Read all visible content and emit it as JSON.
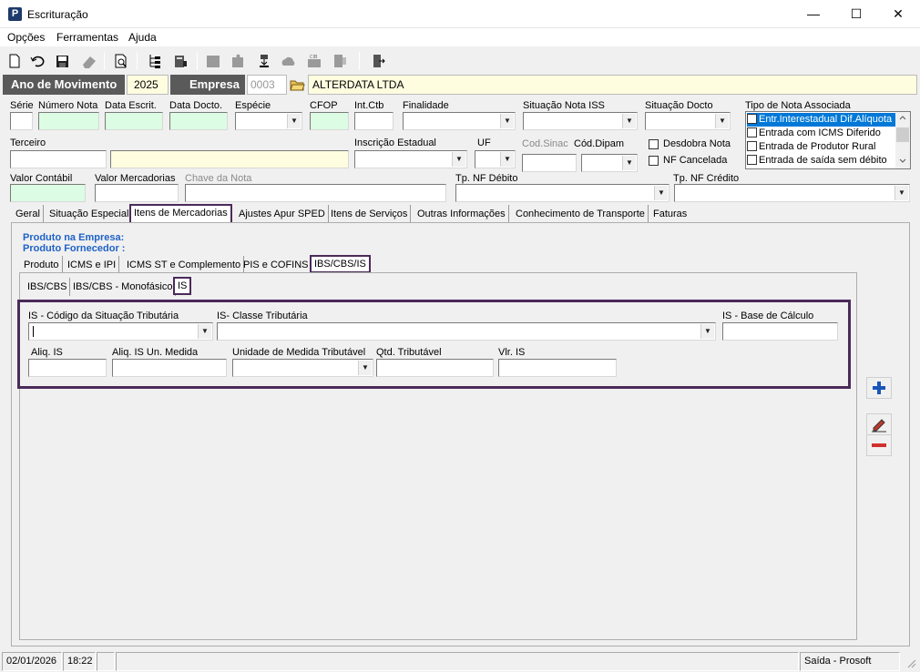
{
  "window": {
    "title": "Escrituração",
    "app_icon_letter": "P",
    "minimize": "—",
    "maximize": "☐",
    "close": "✕"
  },
  "menu": [
    "Opções",
    "Ferramentas",
    "Ajuda"
  ],
  "toolbar_icons": [
    "new-document-icon",
    "undo-icon",
    "save-icon",
    "eraser-icon",
    "print-preview-icon",
    "tree-view-icon",
    "book-icon",
    "folder-icon",
    "puzzle-icon",
    "import-icon",
    "cloud-icon",
    "cib-icon",
    "export-icon",
    "exit-door-icon"
  ],
  "header": {
    "ano_label": "Ano de Movimento",
    "ano_value": "2025",
    "empresa_label": "Empresa",
    "empresa_code": "0003",
    "empresa_name": "ALTERDATA LTDA"
  },
  "form": {
    "serie": "Série",
    "numero_nota": "Número Nota",
    "data_escrit": "Data Escrit.",
    "data_docto": "Data Docto.",
    "especie": "Espécie",
    "cfop": "CFOP",
    "int_ctb": "Int.Ctb",
    "finalidade": "Finalidade",
    "situacao_nota_iss": "Situação Nota ISS",
    "situacao_docto": "Situação Docto",
    "tipo_nota_associada": "Tipo de Nota Associada",
    "terceiro": "Terceiro",
    "inscricao_estadual": "Inscrição Estadual",
    "uf": "UF",
    "cod_sinac": "Cod.Sinac",
    "cod_dipam": "Cód.Dipam",
    "desdobra_nota": "Desdobra Nota",
    "nf_cancelada": "NF Cancelada",
    "valor_contabil": "Valor Contábil",
    "valor_mercadorias": "Valor Mercadorias",
    "chave_nota": "Chave da Nota",
    "tp_nf_debito": "Tp. NF Débito",
    "tp_nf_credito": "Tp. NF Crédito"
  },
  "tipo_nota_list": [
    "Entr.Interestadual Dif.Alíquota",
    "Entrada com ICMS Diferido",
    "Entrada de Produtor Rural",
    "Entrada de saída sem débito"
  ],
  "main_tabs": [
    "Geral",
    "Situação Especial",
    "Itens de Mercadorias",
    "Ajustes Apur SPED",
    "Itens de Serviços",
    "Outras Informações",
    "Conhecimento de Transporte",
    "Faturas"
  ],
  "produto_empresa": "Produto na Empresa:",
  "produto_fornecedor": "Produto Fornecedor :",
  "sub_tabs": [
    "Produto",
    "ICMS e IPI",
    "ICMS ST e Complemento",
    "PIS e COFINS",
    "IBS/CBS/IS"
  ],
  "sub_sub_tabs": [
    "IBS/CBS",
    "IBS/CBS - Monofásico",
    "IS"
  ],
  "is_panel": {
    "cst": "IS - Código da Situação Tributária",
    "classe": "IS- Classe Tributária",
    "base": "IS - Base de Cálculo",
    "aliq": "Aliq. IS",
    "aliq_un": "Aliq. IS Un. Medida",
    "unidade": "Unidade de Medida Tributável",
    "qtd": "Qtd. Tributável",
    "vlr": "Vlr. IS"
  },
  "status": {
    "date": "02/01/2026",
    "time": "18:22",
    "mode": "Saída - Prosoft"
  },
  "colors": {
    "highlight_border": "#4b2a5a",
    "header_bg": "#5a5a5a",
    "required_bg": "#dcfce3",
    "optional_bg": "#fffde0",
    "link_blue": "#1f62c7"
  }
}
